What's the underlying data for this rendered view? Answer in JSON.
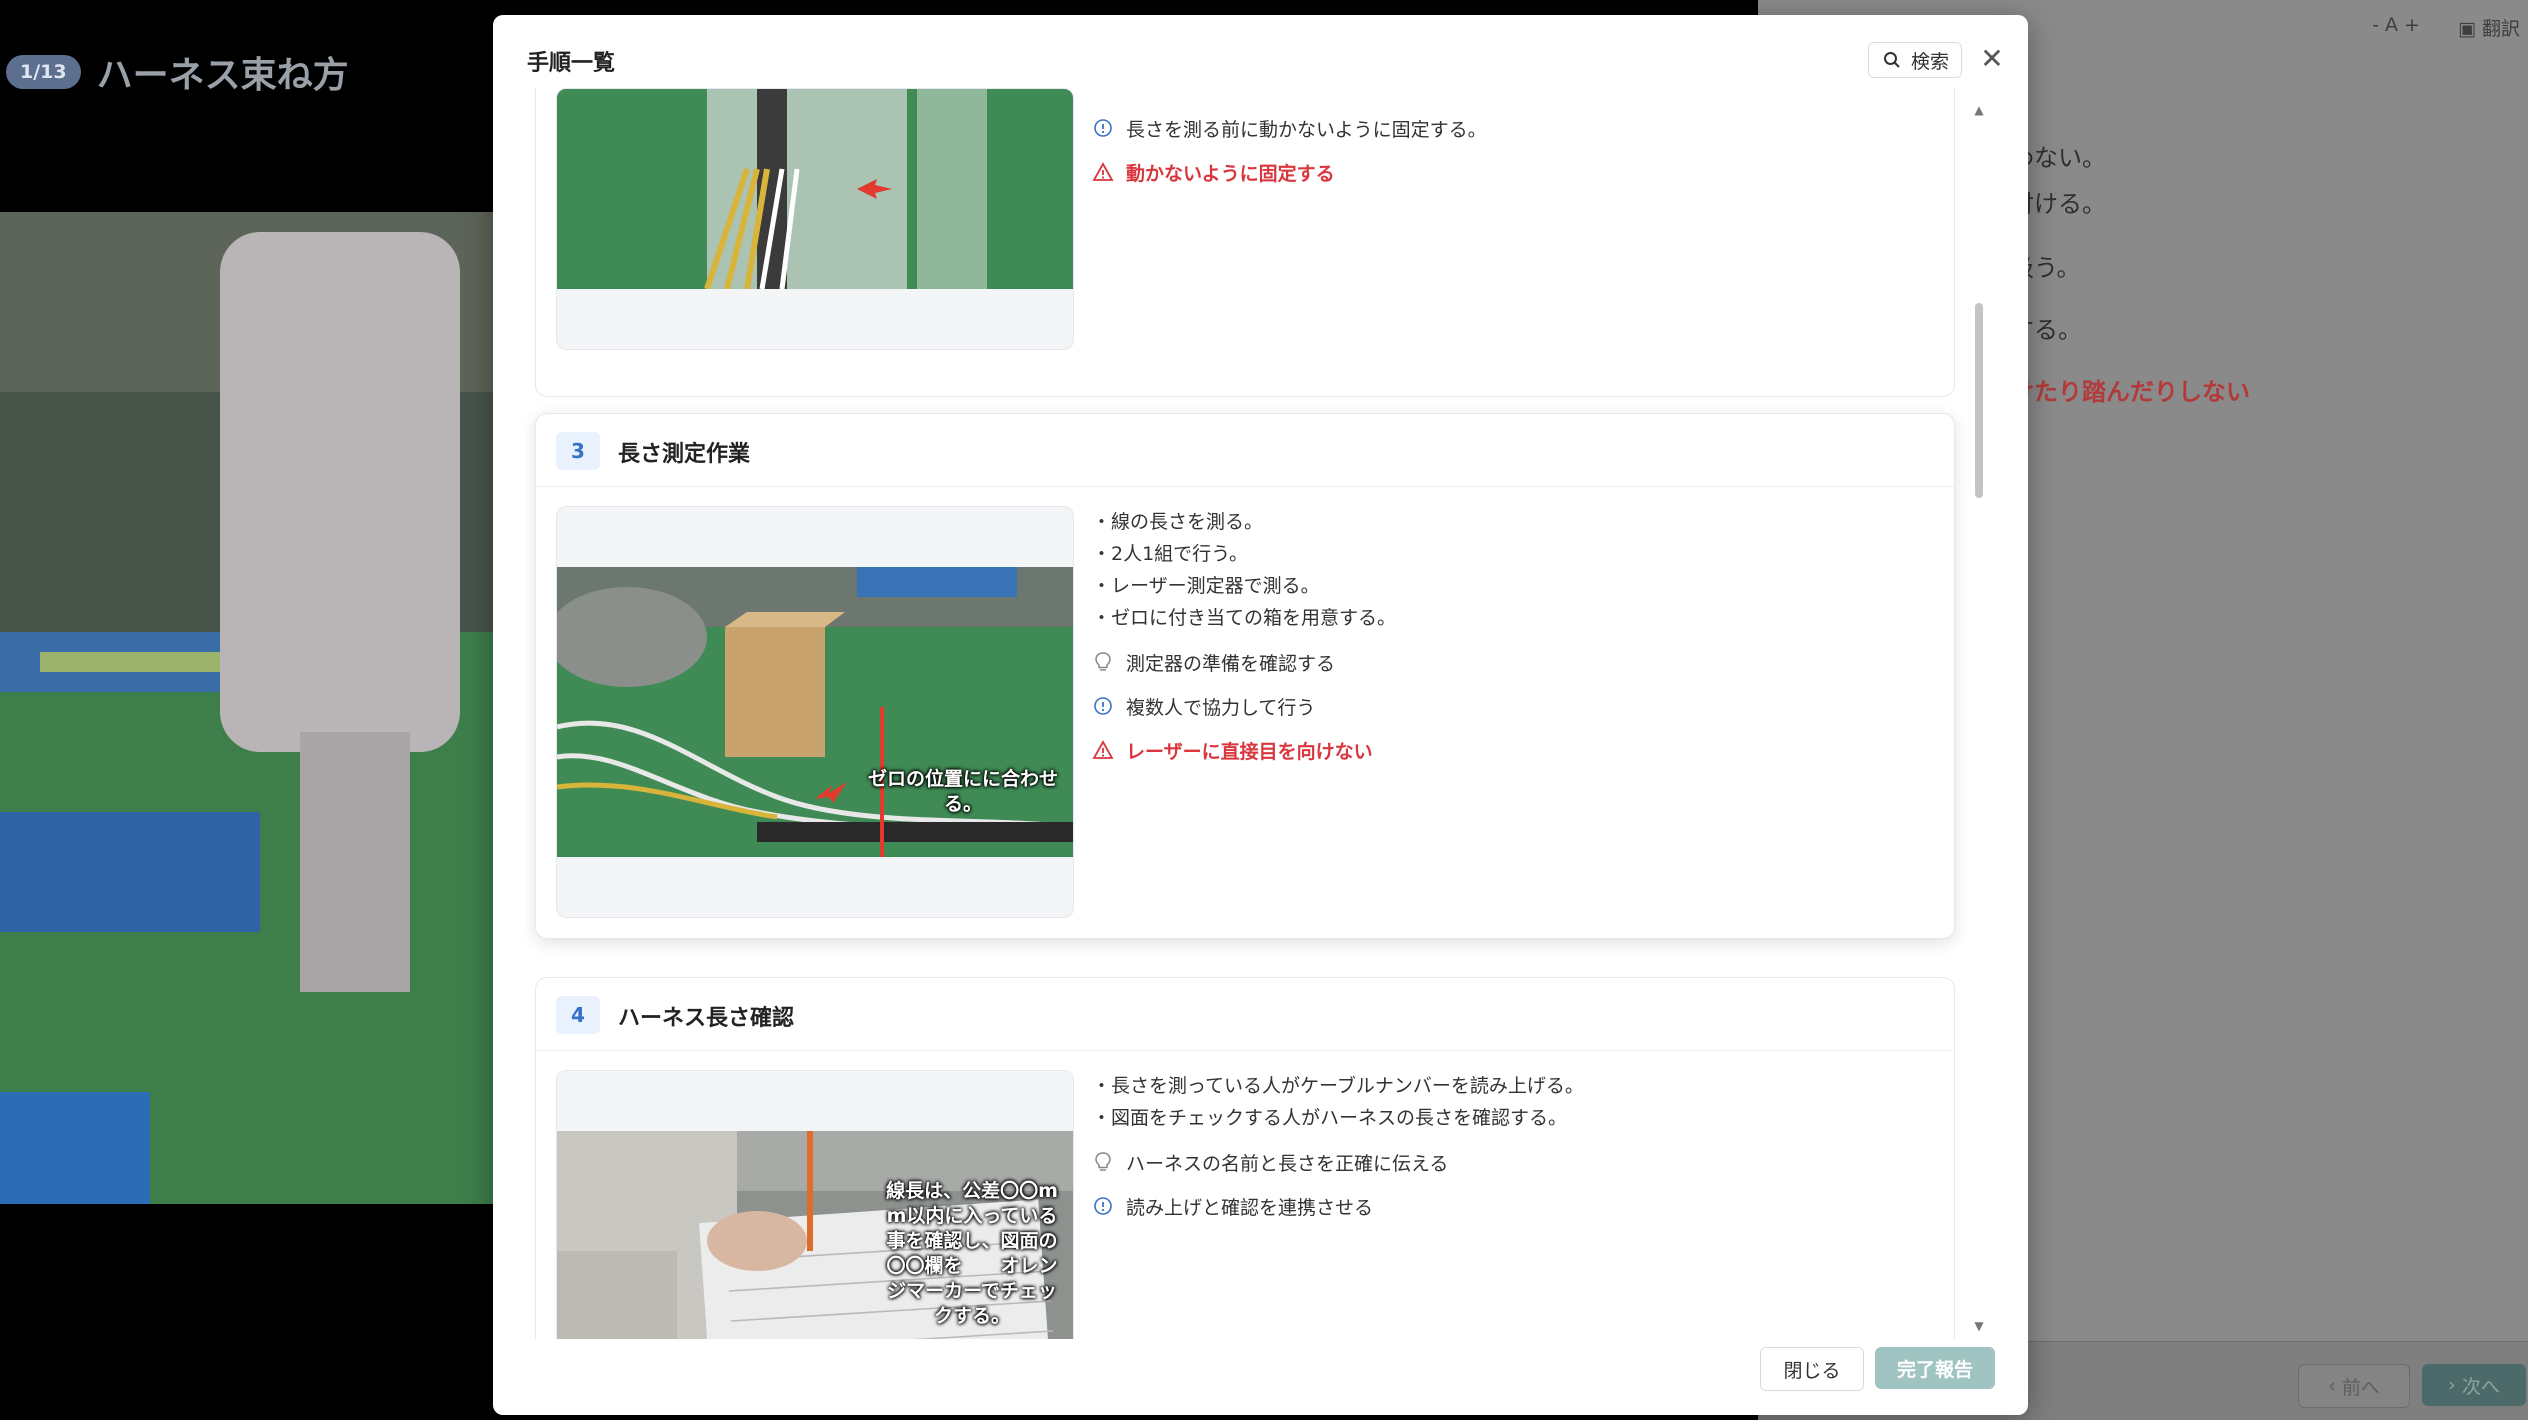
{
  "background": {
    "page_counter": "1/13",
    "page_title": "ハーネス束ね方",
    "right_panel": {
      "font_size_control": "- A +",
      "translate_label": "翻訳",
      "lines": [
        "わない。",
        "付ける。",
        "扱う。",
        "する。"
      ],
      "warning_line": "けたり踏んだりしない",
      "prev_label": "前へ",
      "next_label": "次へ"
    }
  },
  "modal": {
    "title": "手順一覧",
    "search_label": "検索",
    "steps": [
      {
        "number": "",
        "title": "",
        "bullets": [],
        "notes": [
          {
            "type": "info",
            "text": "長さを測る前に動かないように固定する。"
          },
          {
            "type": "warning",
            "text": "動かないように固定する"
          }
        ]
      },
      {
        "number": "3",
        "title": "長さ測定作業",
        "bullets": [
          "・線の長さを測る。",
          "・2人1組で行う。",
          "・レーザー測定器で測る。",
          "・ゼロに付き当ての箱を用意する。"
        ],
        "notes": [
          {
            "type": "tip",
            "text": "測定器の準備を確認する"
          },
          {
            "type": "info",
            "text": "複数人で協力して行う"
          },
          {
            "type": "warning",
            "text": "レーザーに直接目を向けない"
          }
        ],
        "image_caption": [
          "ゼロの位置にに合わせ",
          "る。"
        ]
      },
      {
        "number": "4",
        "title": "ハーネス長さ確認",
        "bullets": [
          "・長さを測っている人がケーブルナンバーを読み上げる。",
          "・図面をチェックする人がハーネスの長さを確認する。"
        ],
        "notes": [
          {
            "type": "tip",
            "text": "ハーネスの名前と長さを正確に伝える"
          },
          {
            "type": "info",
            "text": "読み上げと確認を連携させる"
          }
        ],
        "image_caption": [
          "線長は、公差〇〇m",
          "m以内に入っている",
          "事を確認し、図面の",
          "〇〇欄を　　オレン",
          "ジマーカーでチェッ",
          "クする。"
        ]
      }
    ],
    "close_button": "閉じる",
    "complete_button": "完了報告"
  },
  "colors": {
    "warning": "#d9363e",
    "info": "#3872c8",
    "accent_disabled": "#9fc4c1"
  }
}
